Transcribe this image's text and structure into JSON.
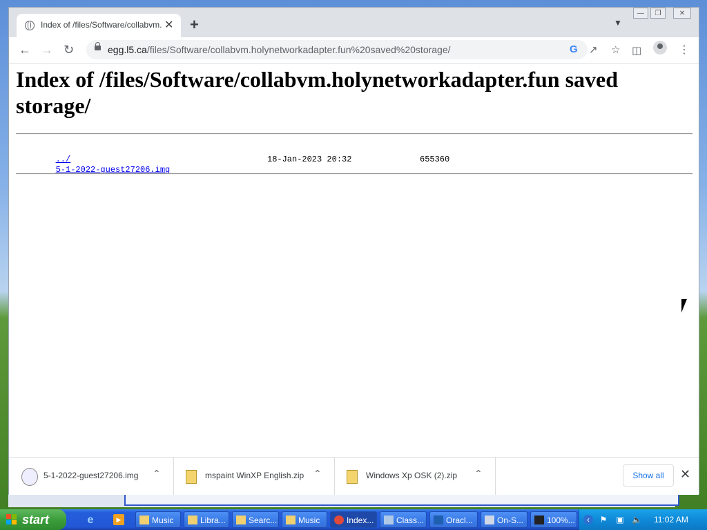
{
  "browser": {
    "tab_title": "Index of /files/Software/collabvm.holynetworkadapter.fun saved storage/",
    "tab_close": "✕",
    "new_tab": "+",
    "tab_menu": "⌄",
    "url_host": "egg.l5.ca",
    "url_path": "/files/Software/collabvm.holynetworkadapter.fun%20saved%20storage/",
    "window_controls": [
      "—",
      "❐",
      "✕"
    ]
  },
  "page": {
    "heading": "Index of /files/Software/collabvm.holynetworkadapter.fun saved storage/",
    "rows": [
      {
        "name": "../",
        "date": "",
        "size": ""
      },
      {
        "name": "5-1-2022-guest27206.img",
        "date": "18-Jan-2023 20:32",
        "size": "655360"
      }
    ]
  },
  "downloads": {
    "items": [
      {
        "name": "5-1-2022-guest27206.img",
        "icon": "file-icon"
      },
      {
        "name": "mspaint WinXP English.zip",
        "icon": "zip-icon"
      },
      {
        "name": "Windows Xp OSK (2).zip",
        "icon": "zip-icon"
      }
    ],
    "show_all": "Show all",
    "close": "✕"
  },
  "taskbar": {
    "start": "start",
    "buttons": [
      {
        "label": "Music",
        "icon": "folder-icon"
      },
      {
        "label": "Libra...",
        "icon": "folder-icon"
      },
      {
        "label": "Searc...",
        "icon": "folder-icon"
      },
      {
        "label": "Music",
        "icon": "folder-icon"
      },
      {
        "label": "Index...",
        "icon": "chrome-icon",
        "active": true
      },
      {
        "label": "Class...",
        "icon": "app-icon"
      },
      {
        "label": "Oracl...",
        "icon": "virtualbox-icon"
      },
      {
        "label": "On-S...",
        "icon": "keyboard-icon"
      },
      {
        "label": "100%...",
        "icon": "7zip-icon"
      }
    ],
    "clock": "11:02 AM"
  },
  "colors": {
    "link": "#0000ee",
    "chrome_tabstrip": "#dee1e6",
    "xp_taskbar": "#245edb",
    "xp_start": "#3c9e3c"
  }
}
